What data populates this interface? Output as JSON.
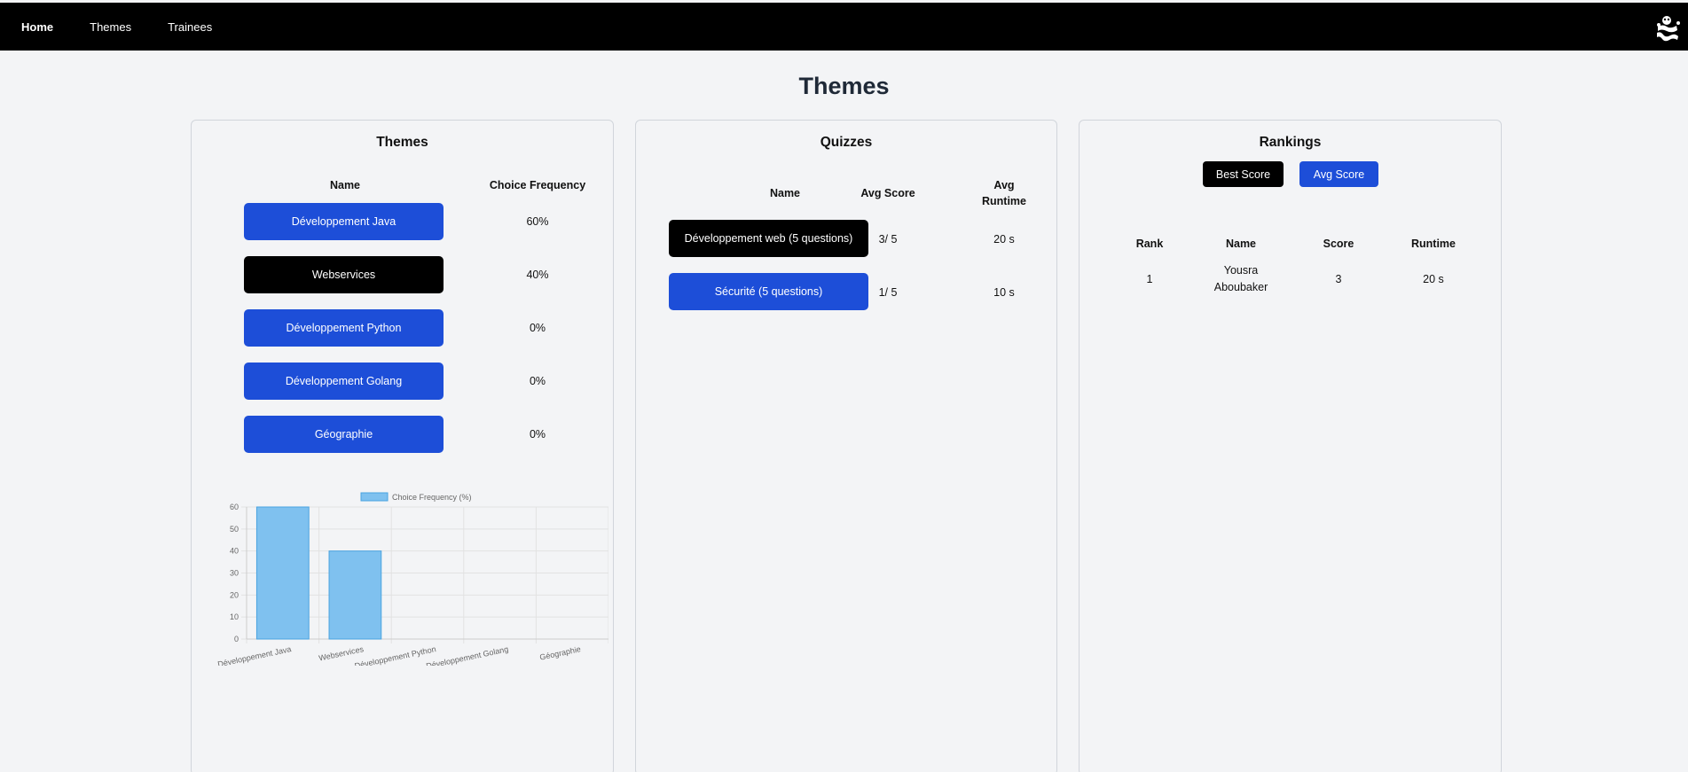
{
  "nav": {
    "links": [
      "Home",
      "Themes",
      "Trainees"
    ]
  },
  "page": {
    "title": "Themes"
  },
  "themes_card": {
    "title": "Themes",
    "col_name": "Name",
    "col_freq": "Choice Frequency",
    "rows": [
      {
        "name": "Développement Java",
        "freq": "60%"
      },
      {
        "name": "Webservices",
        "freq": "40%"
      },
      {
        "name": "Développement Python",
        "freq": "0%"
      },
      {
        "name": "Développement Golang",
        "freq": "0%"
      },
      {
        "name": "Géographie",
        "freq": "0%"
      }
    ]
  },
  "quizzes_card": {
    "title": "Quizzes",
    "col_name": "Name",
    "col_score": "Avg Score",
    "col_runtime_1": "Avg",
    "col_runtime_2": "Runtime",
    "rows": [
      {
        "name": "Développement web (5 questions)",
        "score": "3/ 5",
        "runtime": "20 s"
      },
      {
        "name": "Sécurité (5 questions)",
        "score": "1/ 5",
        "runtime": "10 s"
      }
    ]
  },
  "rankings_card": {
    "title": "Rankings",
    "btn_best": "Best Score",
    "btn_avg": "Avg Score",
    "col_rank": "Rank",
    "col_name": "Name",
    "col_score": "Score",
    "col_runtime": "Runtime",
    "rows": [
      {
        "rank": "1",
        "name_1": "Yousra",
        "name_2": "Aboubaker",
        "score": "3",
        "runtime": "20 s"
      }
    ]
  },
  "colors": {
    "nav_bg": "#000000",
    "primary_blue": "#1d4ed8",
    "selected_black": "#000000",
    "bar_fill": "#7fc1ef",
    "bar_stroke": "#4aa3e0"
  },
  "chart_data": {
    "type": "bar",
    "categories": [
      "Développement Java",
      "Webservices",
      "Développement Python",
      "Développement Golang",
      "Géographie"
    ],
    "series": [
      {
        "name": "Choice Frequency (%)",
        "values": [
          60,
          40,
          0,
          0,
          0
        ]
      }
    ],
    "yticks": [
      "0",
      "10",
      "20",
      "30",
      "40",
      "50",
      "60"
    ],
    "ylim": [
      0,
      60
    ],
    "grid": true,
    "legend": "top"
  }
}
